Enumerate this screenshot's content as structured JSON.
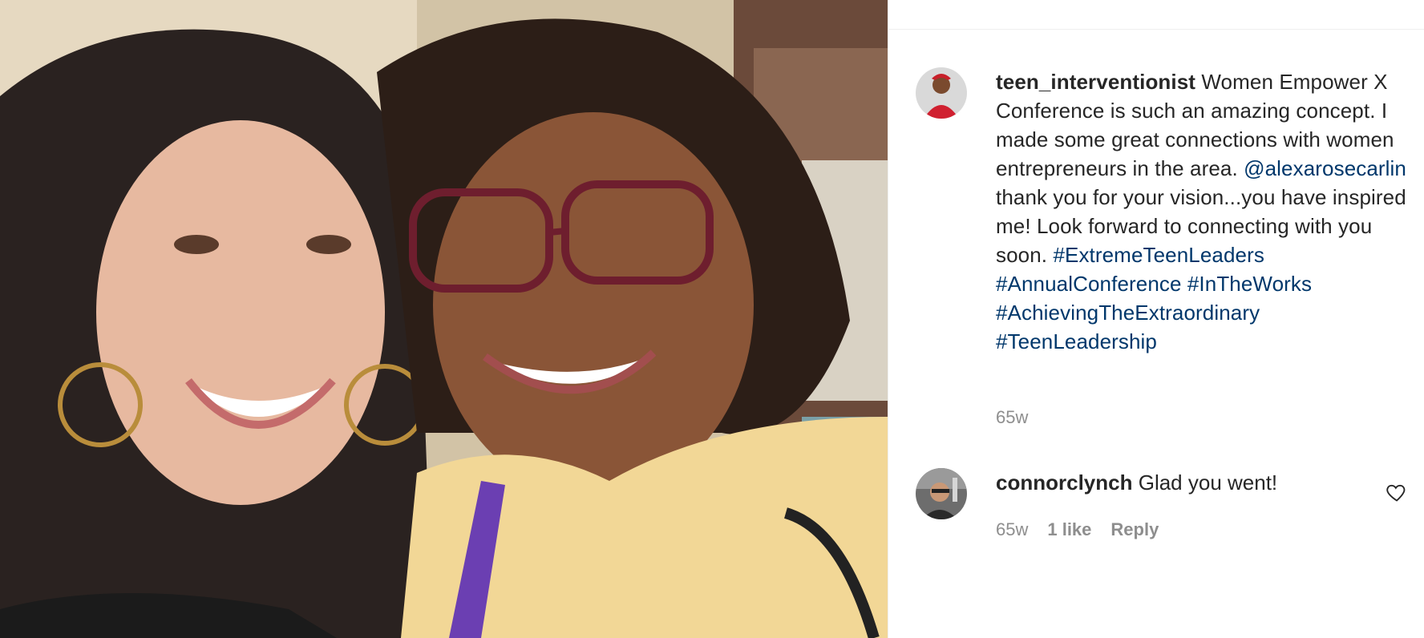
{
  "post": {
    "caption": {
      "username": "teen_interventionist",
      "text_1": "Women Empower X Conference is such an amazing concept. I made some great connections with women entrepreneurs in the area.",
      "mention": "@alexarosecarlin",
      "text_2": "thank you for your vision...you have inspired me! Look forward to connecting with you soon.",
      "hashtags": [
        "#ExtremeTeenLeaders",
        "#AnnualConference",
        "#InTheWorks",
        "#AchievingTheExtraordinary",
        "#TeenLeadership"
      ],
      "time": "65w"
    },
    "comments": [
      {
        "username": "connorclynch",
        "text": "Glad you went!",
        "time": "65w",
        "likes": "1 like",
        "reply_label": "Reply"
      }
    ]
  },
  "colors": {
    "link": "#00376b",
    "text": "#262626",
    "muted": "#8e8e8e",
    "border": "#efefef"
  },
  "icons": {
    "like": "heart-outline-icon"
  }
}
